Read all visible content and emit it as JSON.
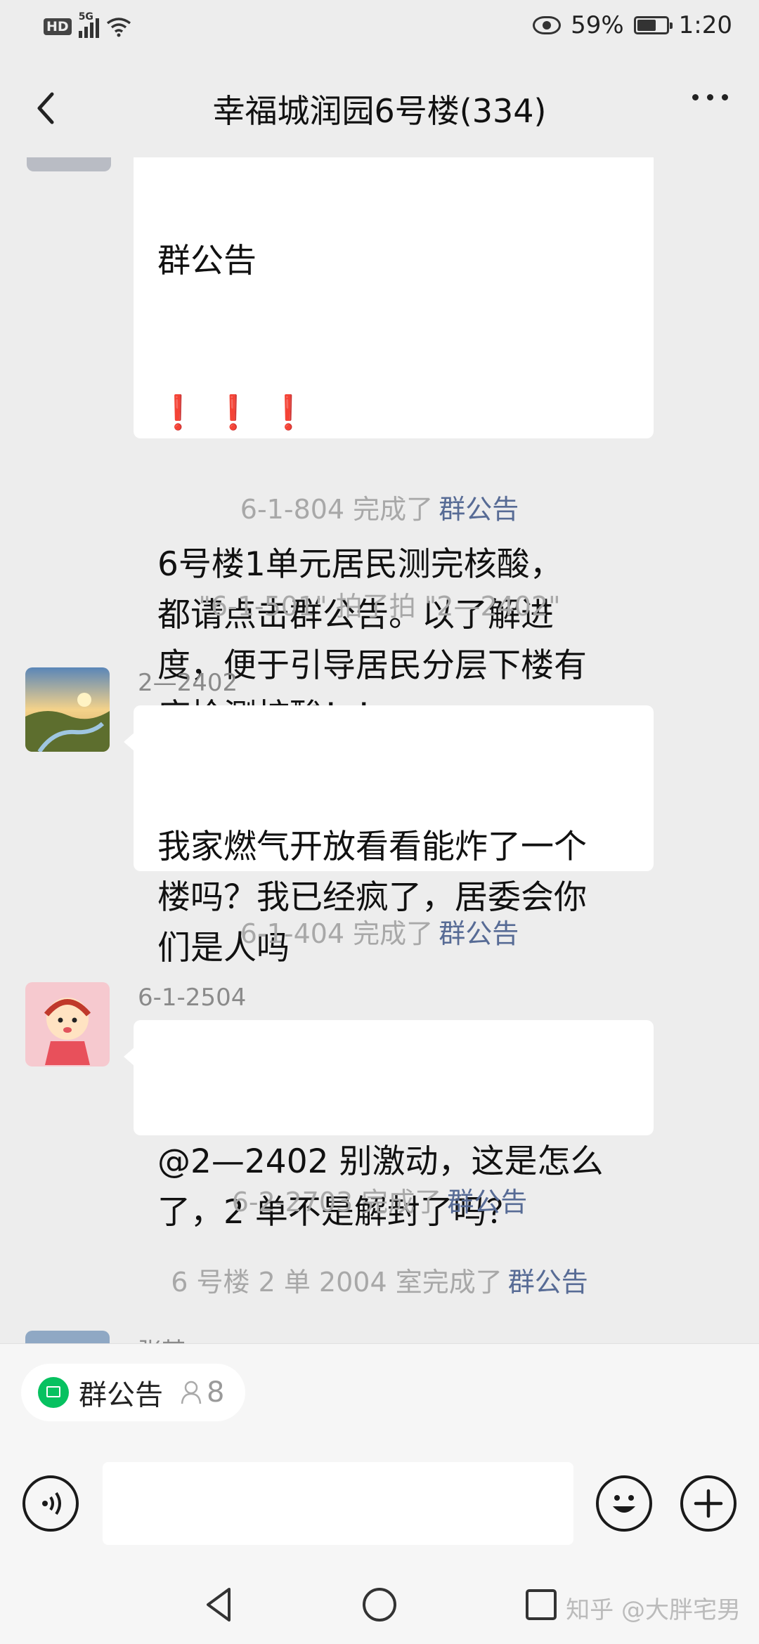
{
  "status_bar": {
    "hd": "HD",
    "network": "5G",
    "battery": "59%",
    "time": "1:20"
  },
  "header": {
    "title": "幸福城润园6号楼(334)"
  },
  "messages": {
    "notice": {
      "clipped_top": "群公告",
      "marks": "❗❗❗",
      "text": "6号楼1单元居民测完核酸，\n都请点击群公告。以了解进\n度，便于引导居民分层下楼有\n序检测核酸！！"
    },
    "sys1": {
      "text": "6-1-804 完成了",
      "link": "群公告"
    },
    "sys2": {
      "text": "\"6-1-501\" 拍了拍 \"2—2402\""
    },
    "msg1": {
      "sender": "2—2402",
      "text": "我家燃气开放看看能炸了一个\n楼吗？我已经疯了，居委会你\n们是人吗"
    },
    "sys3": {
      "text": "6-1-404 完成了",
      "link": "群公告"
    },
    "msg2": {
      "sender": "6-1-2504",
      "text": "@2—2402 别激动，这是怎么\n了，2 单不是解封了吗？"
    },
    "sys4": {
      "text": "6-2-2703 完成了",
      "link": "群公告"
    },
    "sys5": {
      "text": "6 号楼 2 单 2004 室完成了",
      "link": "群公告"
    },
    "msg3": {
      "sender": "张某"
    }
  },
  "bottom": {
    "chip_label": "群公告",
    "chip_count": "8"
  },
  "watermark": "知乎 @大胖宅男",
  "icons": [
    "back-arrow-icon",
    "more-icon",
    "voice-icon",
    "emoji-icon",
    "plus-icon",
    "nav-back-icon",
    "nav-home-icon",
    "nav-recent-icon"
  ]
}
